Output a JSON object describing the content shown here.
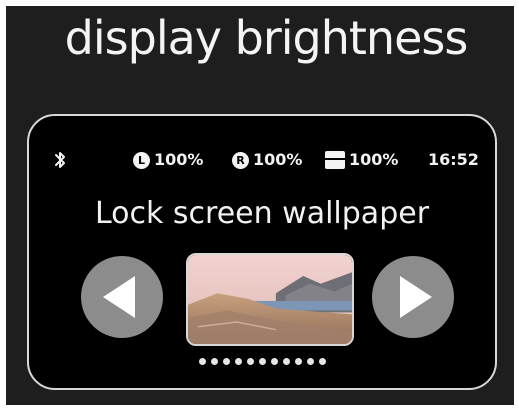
{
  "header": {
    "title": "display brightness"
  },
  "device": {
    "status_bar": {
      "bluetooth_icon": "bluetooth-icon",
      "items": [
        {
          "icon": "L",
          "icon_name": "left-earbud-icon",
          "value": "100%"
        },
        {
          "icon": "R",
          "icon_name": "right-earbud-icon",
          "value": "100%"
        },
        {
          "icon": "",
          "icon_name": "case-battery-icon",
          "value": "100%"
        }
      ],
      "time": "16:52"
    },
    "title": "Lock screen wallpaper",
    "carousel": {
      "prev_icon": "chevron-left-icon",
      "next_icon": "chevron-right-icon",
      "thumbnail": "wallpaper-mountain-lake",
      "page_count": 11,
      "current_page": 1
    }
  },
  "colors": {
    "background": "#1e1e1e",
    "card": "#000000",
    "card_border": "#d8d8d8",
    "nav_button": "#8c8c8c",
    "text": "#f2f2f2"
  }
}
